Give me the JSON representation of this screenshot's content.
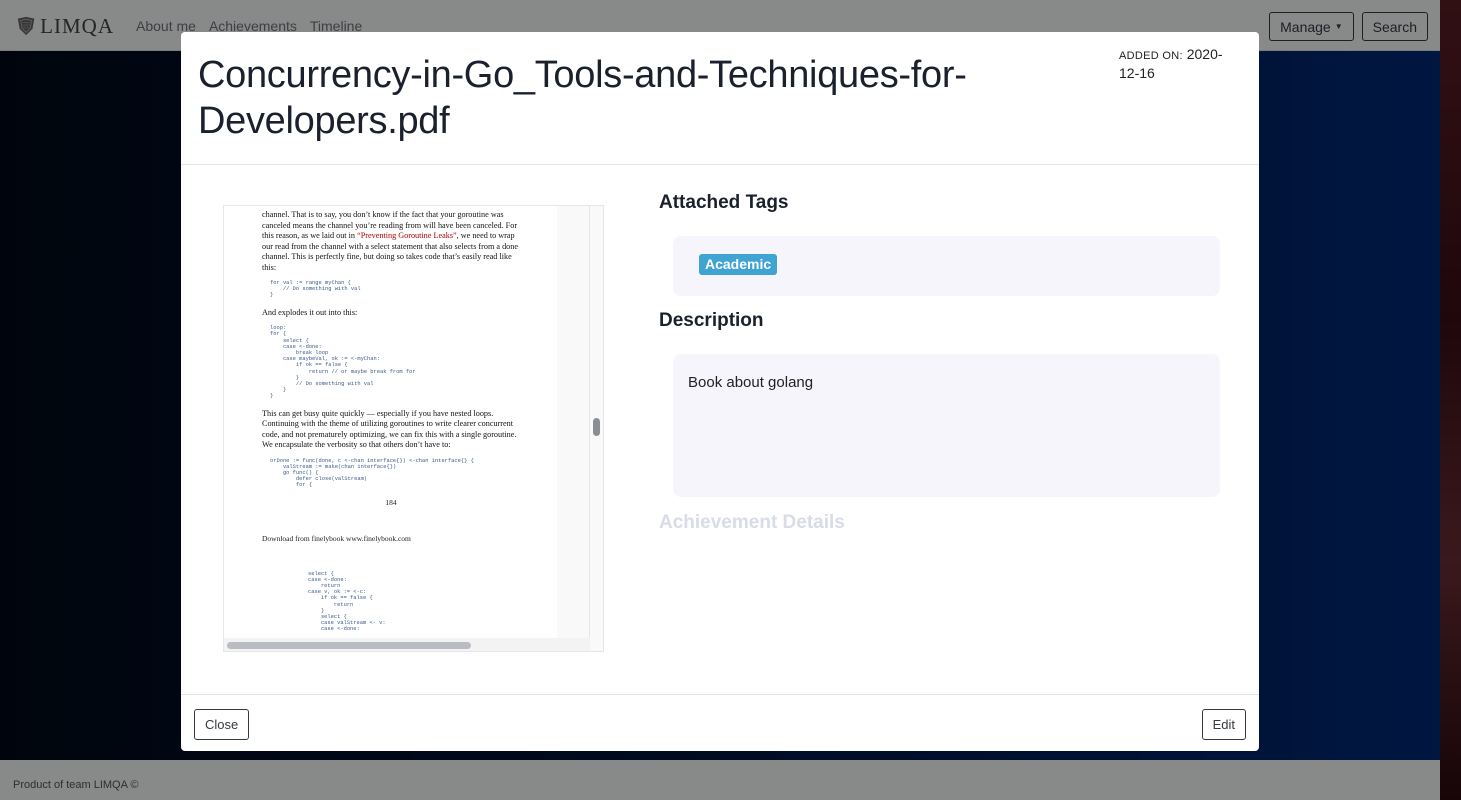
{
  "navbar": {
    "brand": "LIMQA",
    "links": [
      "About me",
      "Achievements",
      "Timeline"
    ],
    "manage_label": "Manage",
    "search_label": "Search"
  },
  "footer": {
    "text": "Product of team LIMQA ©"
  },
  "modal": {
    "title": "Concurrency-in-Go_Tools-and-Techniques-for-Developers.pdf",
    "added_label": "ADDED ON:",
    "added_date": "2020-12-16",
    "attached_tags_heading": "Attached Tags",
    "tags": [
      "Academic"
    ],
    "tag_color": "#3fa3d3",
    "description_heading": "Description",
    "description": "Book about golang",
    "achievement_details_heading": "Achievement Details",
    "close_label": "Close",
    "edit_label": "Edit"
  },
  "pdf_preview": {
    "para1_a": "channel. That is to say, you don’t know if the fact that your goroutine was canceled means the channel you’re reading from will have been canceled. For this reason, as we laid out in ",
    "para1_link": "“Preventing Goroutine Leaks”",
    "para1_b": ", we need to wrap our read from the channel with a select statement that also selects from a done channel. This is perfectly fine, but doing so takes code that’s easily read like this:",
    "code1": "for val := range myChan {\n    // Do something with val\n}",
    "para2": "And explodes it out into this:",
    "code2": "loop:\nfor {\n    select {\n    case <-done:\n        break loop\n    case maybeVal, ok := <-myChan:\n        if ok == false {\n            return // or maybe break from for\n        }\n        // Do something with val\n    }\n}",
    "para3": "This can get busy quite quickly — especially if you have nested loops. Continuing with the theme of utilizing goroutines to write clearer concurrent code, and not prematurely optimizing, we can fix this with a single goroutine. We encapsulate the verbosity so that others don’t have to:",
    "code3": "orDone := func(done, c <-chan interface{}) <-chan interface{} {\n    valStream := make(chan interface{})\n    go func() {\n        defer close(valStream)\n        for {",
    "page_number": "184",
    "download": "Download from finelybook www.finelybook.com",
    "code4": "select {\ncase <-done:\n    return\ncase v, ok := <-c:\n    if ok == false {\n        return\n    }\n    select {\n    case valStream <- v:\n    case <-done:"
  }
}
